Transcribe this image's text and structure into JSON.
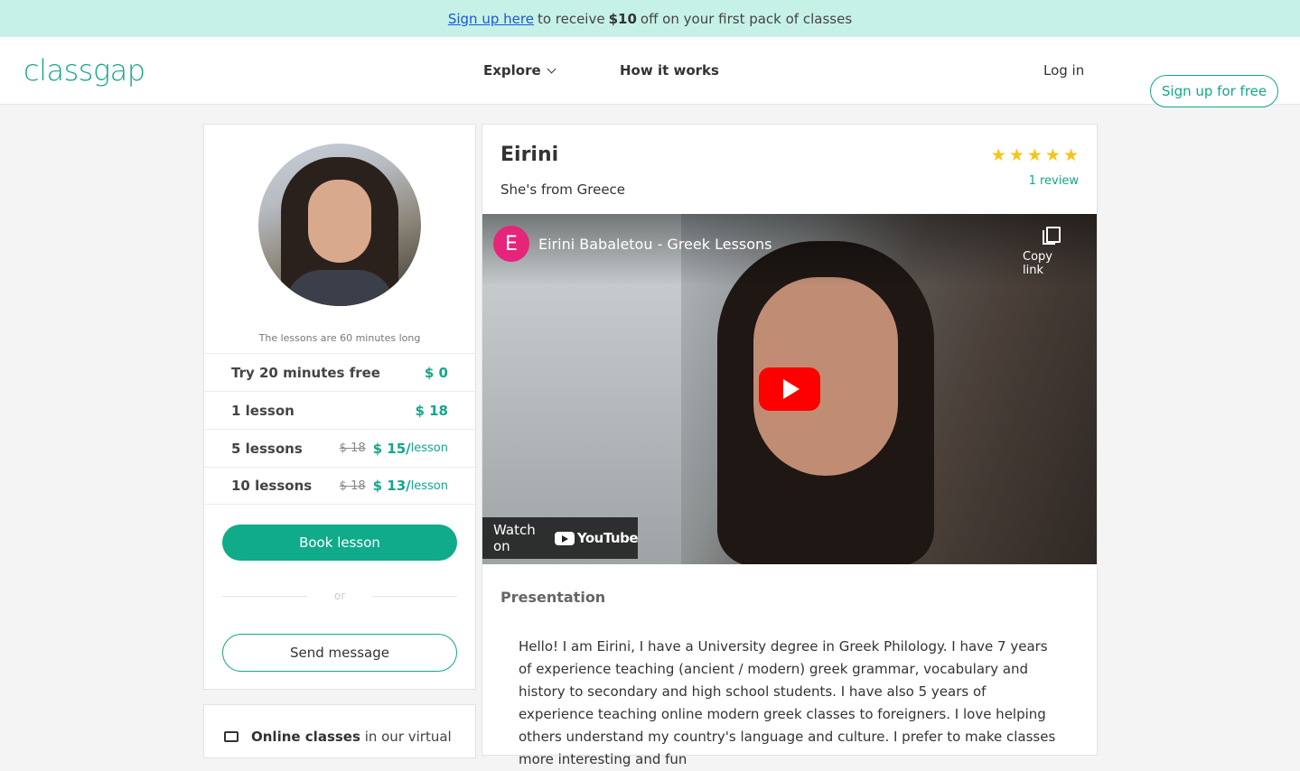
{
  "promo": {
    "link": "Sign up here",
    "text_before": "to receive",
    "amount": "$10",
    "text_after": "off on your first pack of classes"
  },
  "nav": {
    "logo": "classgap",
    "explore": "Explore",
    "how_it_works": "How it works",
    "login": "Log in",
    "signup": "Sign up for free"
  },
  "sidebar": {
    "lesson_length": "The lessons are 60 minutes long",
    "prices": [
      {
        "label": "Try 20 minutes free",
        "old": "",
        "value": "$ 0",
        "unit": ""
      },
      {
        "label": "1 lesson",
        "old": "",
        "value": "$ 18",
        "unit": ""
      },
      {
        "label": "5 lessons",
        "old": "$ 18",
        "value": "$ 15/",
        "unit": "lesson"
      },
      {
        "label": "10 lessons",
        "old": "$ 18",
        "value": "$ 13/",
        "unit": "lesson"
      }
    ],
    "book_button": "Book lesson",
    "or": "or",
    "message_button": "Send message",
    "online_bold": "Online classes",
    "online_rest": "in our virtual"
  },
  "teacher": {
    "name": "Eirini",
    "origin": "She's from Greece",
    "rating": 5,
    "reviews": "1 review",
    "star_color": "#f5c518"
  },
  "video": {
    "channel_initial": "E",
    "title": "Eirini Babaletou - Greek Lessons",
    "copy_link": "Copy link",
    "watch_on": "Watch on",
    "youtube": "YouTube"
  },
  "presentation": {
    "title": "Presentation",
    "text": "Hello! I am Eirini, I have a University degree in Greek Philology. I have 7 years of experience teaching (ancient / modern) greek grammar, vocabulary and history to secondary and high school students. I have also 5 years of experience teaching online modern greek classes to foreigners. I love helping others understand my country's language and culture. I prefer to make classes more interesting and fun"
  },
  "colors": {
    "brand": "#14a68a",
    "promo_bg": "#c6f1e6",
    "page_bg": "#f4f4f5"
  }
}
